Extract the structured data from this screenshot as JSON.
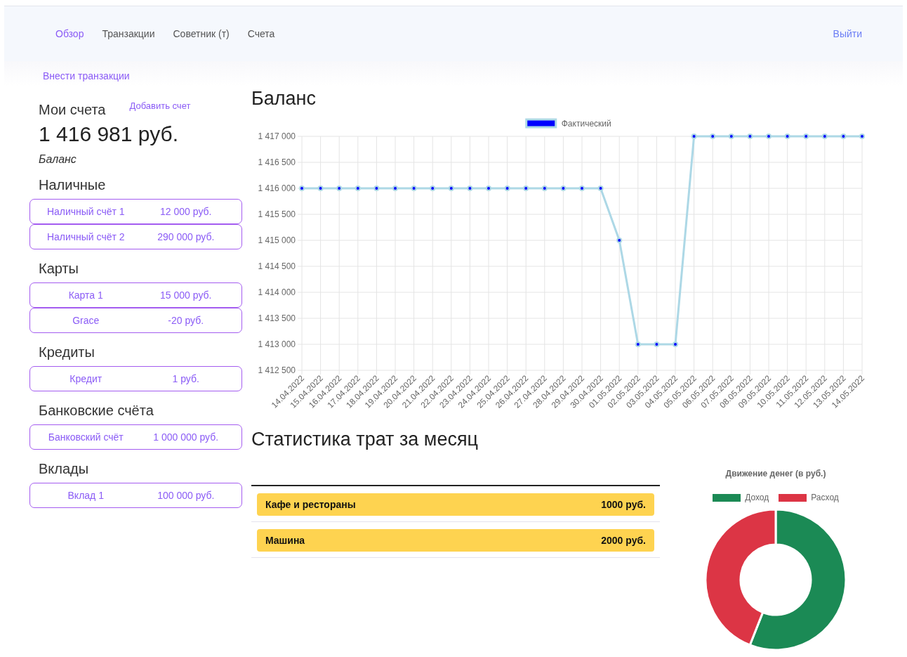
{
  "nav": {
    "items": [
      {
        "label": "Обзор",
        "selected": true
      },
      {
        "label": "Транзакции",
        "selected": false
      },
      {
        "label": "Советник (т)",
        "selected": false
      },
      {
        "label": "Счета",
        "selected": false
      }
    ],
    "logout": "Выйти"
  },
  "subnav": {
    "link": "Внести транзакции"
  },
  "accounts": {
    "title": "Мои счета",
    "add_link": "Добавить счет",
    "total": "1 416 981 руб.",
    "total_caption": "Баланс",
    "groups": [
      {
        "title": "Наличные",
        "items": [
          {
            "name": "Наличный счёт 1",
            "amount": "12 000 руб."
          },
          {
            "name": "Наличный счёт 2",
            "amount": "290 000 руб."
          }
        ]
      },
      {
        "title": "Карты",
        "items": [
          {
            "name": "Карта 1",
            "amount": "15 000 руб."
          },
          {
            "name": "Grace",
            "amount": "-20 руб."
          }
        ]
      },
      {
        "title": "Кредиты",
        "items": [
          {
            "name": "Кредит",
            "amount": "1 руб."
          }
        ]
      },
      {
        "title": "Банковские счёта",
        "items": [
          {
            "name": "Банковский счёт",
            "amount": "1 000 000 руб."
          }
        ]
      },
      {
        "title": "Вклады",
        "items": [
          {
            "name": "Вклад 1",
            "amount": "100 000 руб."
          }
        ]
      }
    ]
  },
  "balance": {
    "title": "Баланс",
    "chart_data": {
      "type": "line",
      "grid": true,
      "categories": [
        "14.04.2022",
        "15.04.2022",
        "16.04.2022",
        "17.04.2022",
        "18.04.2022",
        "19.04.2022",
        "20.04.2022",
        "21.04.2022",
        "22.04.2022",
        "23.04.2022",
        "24.04.2022",
        "25.04.2022",
        "26.04.2022",
        "27.04.2022",
        "28.04.2022",
        "29.04.2022",
        "30.04.2022",
        "01.05.2022",
        "02.05.2022",
        "03.05.2022",
        "04.05.2022",
        "05.05.2022",
        "06.05.2022",
        "07.05.2022",
        "08.05.2022",
        "09.05.2022",
        "10.05.2022",
        "11.05.2022",
        "12.05.2022",
        "13.05.2022",
        "14.05.2022"
      ],
      "series": [
        {
          "name": "Фактический",
          "color": "#add8e6",
          "marker": true,
          "values": [
            1416000,
            1416000,
            1416000,
            1416000,
            1416000,
            1416000,
            1416000,
            1416000,
            1416000,
            1416000,
            1416000,
            1416000,
            1416000,
            1416000,
            1416000,
            1416000,
            1416000,
            1415000,
            1413000,
            1413000,
            1413000,
            1417000,
            1417000,
            1417000,
            1417000,
            1417000,
            1417000,
            1417000,
            1417000,
            1417000,
            1417000
          ]
        }
      ],
      "ylim": [
        1412500,
        1417000
      ],
      "yticks": [
        {
          "value": 1412500,
          "label": "1 412 500"
        },
        {
          "value": 1413000,
          "label": "1 413 000"
        },
        {
          "value": 1413500,
          "label": "1 413 500"
        },
        {
          "value": 1414000,
          "label": "1 414 000"
        },
        {
          "value": 1414500,
          "label": "1 414 500"
        },
        {
          "value": 1415000,
          "label": "1 415 000"
        },
        {
          "value": 1415500,
          "label": "1 415 500"
        },
        {
          "value": 1416000,
          "label": "1 416 000"
        },
        {
          "value": 1416500,
          "label": "1 416 500"
        },
        {
          "value": 1417000,
          "label": "1 417 000"
        }
      ]
    }
  },
  "spending": {
    "title": "Статистика трат за месяц",
    "rows": [
      {
        "category": "Кафе и рестораны",
        "amount": "1000 руб."
      },
      {
        "category": "Машина",
        "amount": "2000 руб."
      }
    ]
  },
  "cashflow": {
    "title": "Движение денег (в руб.)",
    "legend": [
      {
        "label": "Доход",
        "color": "#1b8a55"
      },
      {
        "label": "Расход",
        "color": "#dc3545"
      }
    ]
  }
}
